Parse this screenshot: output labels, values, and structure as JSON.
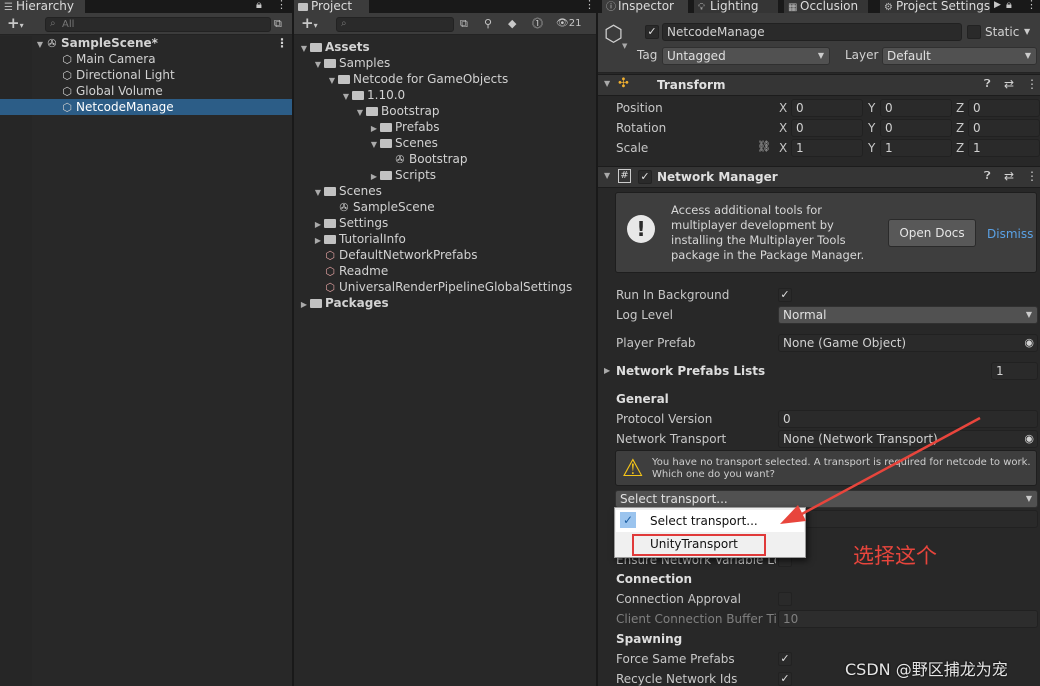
{
  "hierarchy": {
    "tab_label": "Hierarchy",
    "search_placeholder": "All",
    "scene_name": "SampleScene*",
    "items": [
      "Main Camera",
      "Directional Light",
      "Global Volume",
      "NetcodeManage"
    ]
  },
  "project": {
    "tab_label": "Project",
    "hidden_count": "21",
    "tree": {
      "assets": "Assets",
      "samples": "Samples",
      "netcode": "Netcode for GameObjects",
      "version": "1.10.0",
      "bootstrap": "Bootstrap",
      "prefabs": "Prefabs",
      "scenes": "Scenes",
      "bootstrap_scene": "Bootstrap",
      "scripts": "Scripts",
      "scenes_root": "Scenes",
      "sample_scene": "SampleScene",
      "settings": "Settings",
      "tutorial_info": "TutorialInfo",
      "default_network_prefabs": "DefaultNetworkPrefabs",
      "readme": "Readme",
      "urp_settings": "UniversalRenderPipelineGlobalSettings",
      "packages": "Packages"
    }
  },
  "tabs": {
    "inspector": "Inspector",
    "lighting": "Lighting",
    "occlusion": "Occlusion",
    "project_settings": "Project Settings"
  },
  "inspector": {
    "object_name": "NetcodeManage",
    "static_label": "Static",
    "tag_label": "Tag",
    "tag_value": "Untagged",
    "layer_label": "Layer",
    "layer_value": "Default",
    "transform": {
      "title": "Transform",
      "position_label": "Position",
      "rotation_label": "Rotation",
      "scale_label": "Scale",
      "axis_x": "X",
      "axis_y": "Y",
      "axis_z": "Z",
      "position": [
        "0",
        "0",
        "0"
      ],
      "rotation": [
        "0",
        "0",
        "0"
      ],
      "scale": [
        "1",
        "1",
        "1"
      ]
    },
    "network_manager": {
      "title": "Network Manager",
      "info_text": "Access additional tools for multiplayer development by installing the Multiplayer Tools package in the Package Manager.",
      "open_docs": "Open Docs",
      "dismiss": "Dismiss",
      "run_in_background": "Run In Background",
      "log_level_label": "Log Level",
      "log_level_value": "Normal",
      "player_prefab_label": "Player Prefab",
      "player_prefab_value": "None (Game Object)",
      "prefab_lists_label": "Network Prefabs Lists",
      "prefab_lists_count": "1",
      "general": "General",
      "protocol_version_label": "Protocol Version",
      "protocol_version_value": "0",
      "network_transport_label": "Network Transport",
      "network_transport_value": "None (Network Transport)",
      "warning_text": "You have no transport selected. A transport is required for netcode to work. Which one do you want?",
      "select_transport": "Select transport...",
      "ensure_variable": "Ensure Network Variable Ler",
      "connection": "Connection",
      "connection_approval": "Connection Approval",
      "client_buffer": "Client Connection Buffer Tim",
      "client_buffer_value": "10",
      "spawning": "Spawning",
      "force_same_prefabs": "Force Same Prefabs",
      "recycle_ids": "Recycle Network Ids"
    },
    "dropdown_menu": {
      "items": [
        "Select transport...",
        "UnityTransport"
      ],
      "checked_index": 0
    }
  },
  "annotation": {
    "text": "选择这个",
    "color": "#e8453c"
  },
  "watermark": "CSDN @野区捕龙为宠"
}
